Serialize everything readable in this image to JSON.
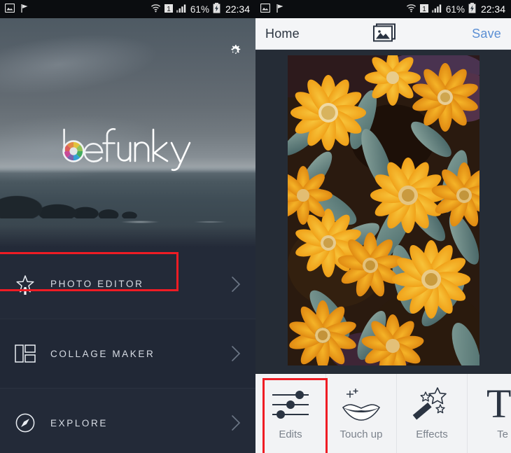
{
  "status_bar": {
    "icons_left": [
      "screenshot-icon",
      "play-flag-icon"
    ],
    "wifi": "wifi-icon",
    "sim": "1",
    "signal": "signal-bars-icon",
    "battery_percent": "61%",
    "battery": "battery-charging-icon",
    "time": "22:34"
  },
  "left_screen": {
    "name": "befunky-home-screen",
    "gear": "gear-icon",
    "logo": {
      "text": "befunky",
      "mark": "color-aperture-icon"
    },
    "menu": [
      {
        "label": "PHOTO EDITOR",
        "icon": "magic-wand-star-icon",
        "chevron": "chevron-right-icon",
        "highlighted": true
      },
      {
        "label": "COLLAGE MAKER",
        "icon": "collage-grid-icon",
        "chevron": "chevron-right-icon",
        "highlighted": false
      },
      {
        "label": "EXPLORE",
        "icon": "compass-icon",
        "chevron": "chevron-right-icon",
        "highlighted": false
      }
    ]
  },
  "right_screen": {
    "name": "befunky-photo-editor-screen",
    "app_bar": {
      "home_label": "Home",
      "image_icon": "photo-stack-icon",
      "save_label": "Save"
    },
    "photo": {
      "alt": "yellow-orange zinnia flowers with teal-green leaves"
    },
    "toolbar": [
      {
        "label": "Edits",
        "icon": "sliders-icon",
        "selected": true
      },
      {
        "label": "Touch up",
        "icon": "lips-sparkle-icon",
        "selected": false
      },
      {
        "label": "Effects",
        "icon": "magic-wand-stars-icon",
        "selected": false
      },
      {
        "label": "Te",
        "icon": "text-t-icon",
        "selected": false
      }
    ]
  },
  "colors": {
    "highlight_red": "#ef1c24",
    "save_blue": "#5b8fd4",
    "panel_navy": "#232a38",
    "toolbar_bg": "#f2f3f5",
    "appbar_bg": "#f4f5f7"
  }
}
